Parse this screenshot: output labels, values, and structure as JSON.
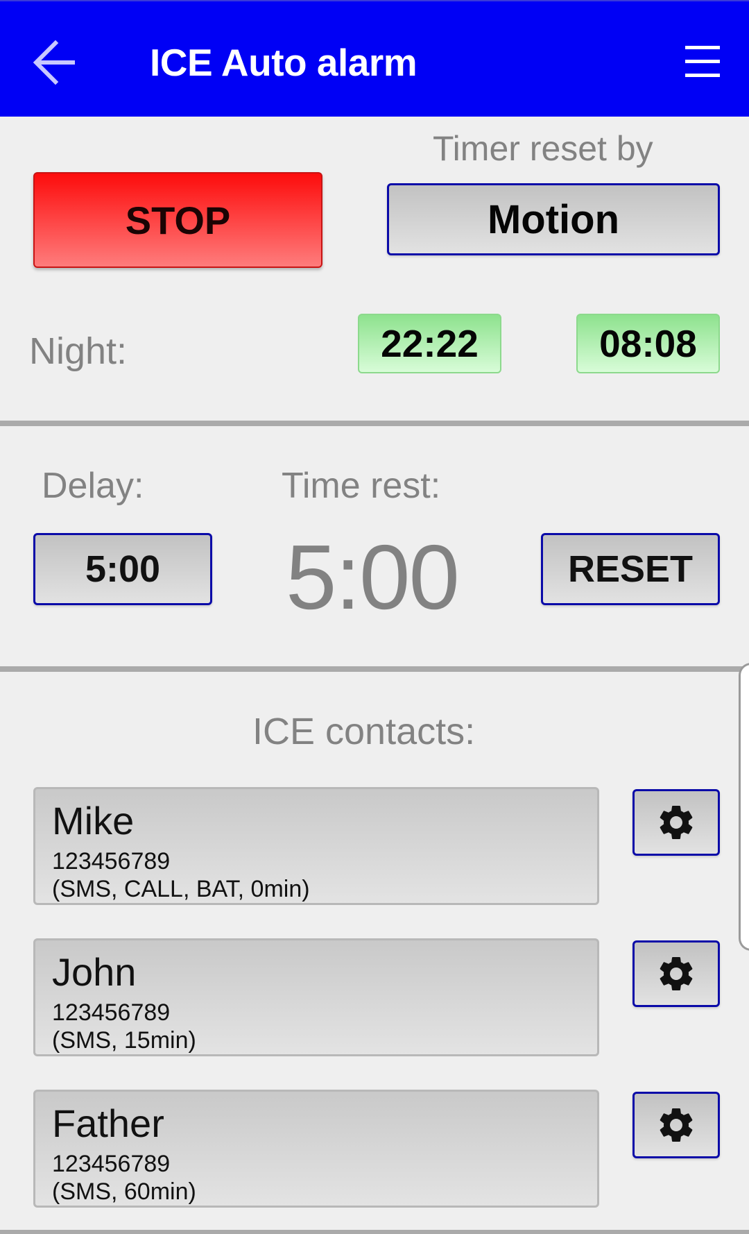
{
  "appbar": {
    "title": "ICE Auto alarm",
    "back_icon": "arrow-left-icon",
    "menu_icon": "hamburger-menu-icon",
    "background_color": "#0000f5"
  },
  "controls": {
    "stop_label": "STOP",
    "timer_reset_by_label": "Timer reset by",
    "timer_reset_by_value": "Motion",
    "night_label": "Night:",
    "night_start": "22:22",
    "night_end": "08:08"
  },
  "timer": {
    "delay_label": "Delay:",
    "delay_value": "5:00",
    "time_rest_label": "Time rest:",
    "time_rest_value": "5:00",
    "reset_label": "RESET"
  },
  "contacts": {
    "heading": "ICE contacts:",
    "items": [
      {
        "name": "Mike",
        "number": "123456789",
        "options": "(SMS, CALL, BAT, 0min)",
        "settings_icon": "gear-icon"
      },
      {
        "name": "John",
        "number": "123456789",
        "options": "(SMS, 15min)",
        "settings_icon": "gear-icon"
      },
      {
        "name": "Father",
        "number": "123456789",
        "options": "(SMS, 60min)",
        "settings_icon": "gear-icon"
      }
    ]
  },
  "colors": {
    "stop_red": "#fd0c0c",
    "button_border_blue": "#0a0aa8",
    "night_time_green": "#8ee28e",
    "label_gray": "#828282"
  }
}
